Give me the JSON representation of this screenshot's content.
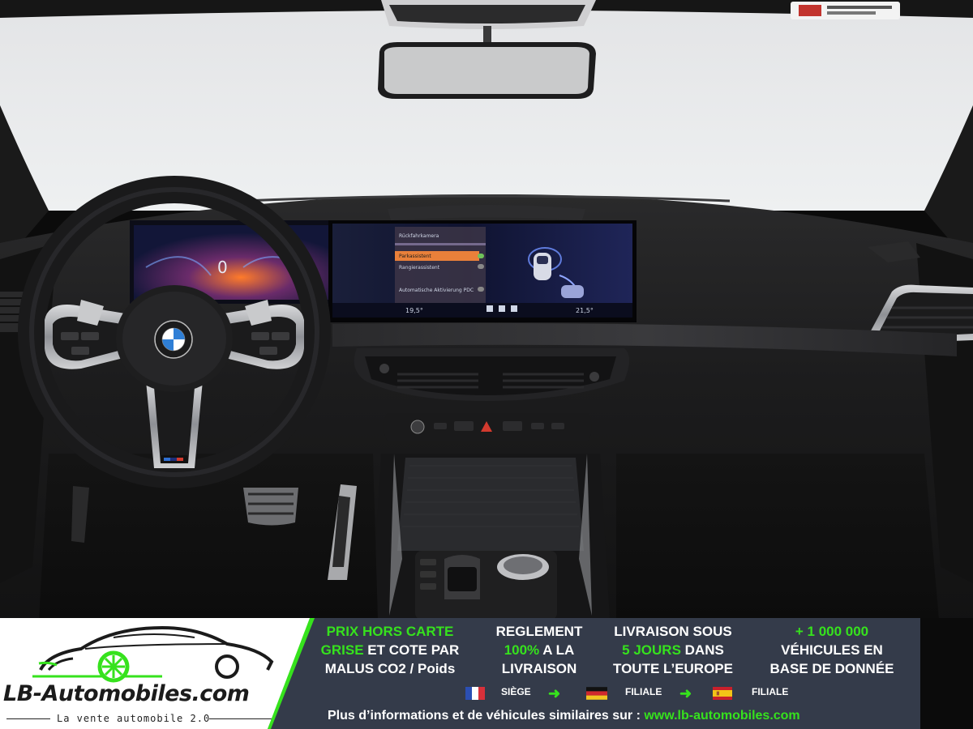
{
  "screen": {
    "speed_value": "0",
    "menu_items": [
      "Rückfahrkamera",
      "Parkassistent",
      "Rangierassistent",
      "Automatische Aktivierung PDC"
    ],
    "temp_left": "19,5°",
    "temp_right": "21,5°"
  },
  "banner": {
    "logo_name": "LB-Automobiles.com",
    "logo_tagline": "La vente automobile 2.0",
    "columns": [
      {
        "lines": [
          {
            "text": "PRIX HORS CARTE",
            "green": true
          },
          {
            "parts": [
              {
                "text": "GRISE",
                "green": true
              },
              {
                "text": " ET COTE PAR",
                "green": false
              }
            ]
          },
          {
            "text": "MALUS CO2 / Poids",
            "green": false
          }
        ]
      },
      {
        "lines": [
          {
            "text": "REGLEMENT",
            "green": false
          },
          {
            "parts": [
              {
                "text": "100%",
                "green": true
              },
              {
                "text": " A LA",
                "green": false
              }
            ]
          },
          {
            "text": "LIVRAISON",
            "green": false
          }
        ]
      },
      {
        "lines": [
          {
            "text": "LIVRAISON SOUS",
            "green": false
          },
          {
            "parts": [
              {
                "text": "5 JOURS",
                "green": true
              },
              {
                "text": " DANS",
                "green": false
              }
            ]
          },
          {
            "text": "TOUTE L’EUROPE",
            "green": false
          }
        ]
      },
      {
        "lines": [
          {
            "text": "+ 1 000 000",
            "green": true
          },
          {
            "text": "VÉHICULES EN",
            "green": false
          },
          {
            "text": "BASE DE DONNÉE",
            "green": false
          }
        ]
      }
    ],
    "flags": {
      "france_label": "SIÈGE",
      "germany_label": "FILIALE",
      "spain_label": "FILIALE"
    },
    "footer_text": "Plus d’informations et de véhicules similaires sur : ",
    "footer_link": "www.lb-automobiles.com",
    "colors": {
      "accent_green": "#36e21d",
      "banner_bg": "#343b4a"
    }
  }
}
